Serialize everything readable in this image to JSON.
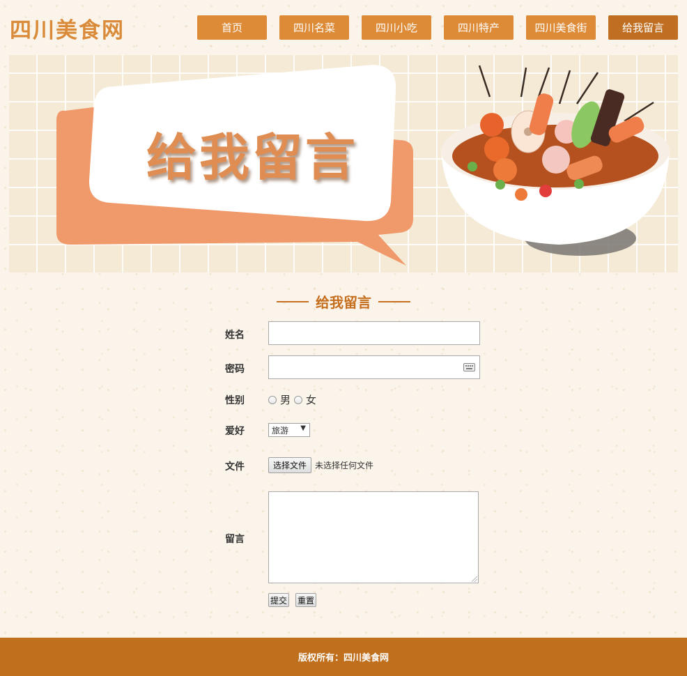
{
  "site": {
    "logo": "四川美食网"
  },
  "nav": {
    "items": [
      {
        "label": "首页"
      },
      {
        "label": "四川名菜"
      },
      {
        "label": "四川小吃"
      },
      {
        "label": "四川特产"
      },
      {
        "label": "四川美食街"
      },
      {
        "label": "给我留言"
      }
    ],
    "active_index": 5
  },
  "banner": {
    "title": "给我留言"
  },
  "section": {
    "title": "给我留言"
  },
  "form": {
    "name_label": "姓名",
    "password_label": "密码",
    "gender_label": "性别",
    "gender_options": [
      "男",
      "女"
    ],
    "hobby_label": "爱好",
    "hobby_selected": "旅游",
    "file_label": "文件",
    "file_button": "选择文件",
    "file_status": "未选择任何文件",
    "message_label": "留言",
    "submit_label": "提交",
    "reset_label": "重置"
  },
  "footer": {
    "text": "版权所有：四川美食网"
  },
  "colors": {
    "accent": "#de8b38",
    "accent_dark": "#c06f1c",
    "background": "#fbf4ea"
  }
}
